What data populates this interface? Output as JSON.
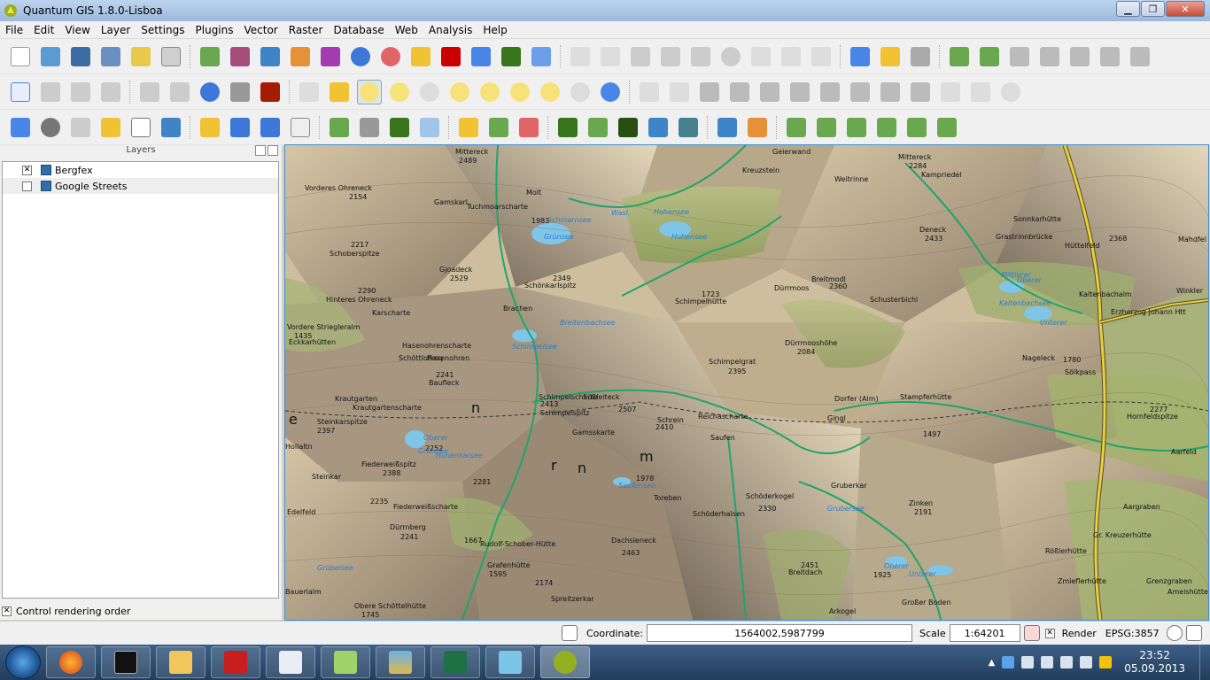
{
  "window": {
    "title": "Quantum GIS 1.8.0-Lisboa"
  },
  "menu": [
    "File",
    "Edit",
    "View",
    "Layer",
    "Settings",
    "Plugins",
    "Vector",
    "Raster",
    "Database",
    "Web",
    "Analysis",
    "Help"
  ],
  "layers": {
    "panel_title": "Layers",
    "items": [
      {
        "label": "Bergfex",
        "checked": true
      },
      {
        "label": "Google Streets",
        "checked": false
      }
    ],
    "control_rendering_order": "Control rendering order"
  },
  "map": {
    "labels": [
      "Mittereck",
      "2489",
      "Vorderes Ohreneck",
      "2154",
      "Gamskarl",
      "Tuchmoarscharte",
      "Molt",
      "1983",
      "Schmarnsee",
      "Grünsee",
      "Wasl.",
      "Hohensee",
      "Hohensee",
      "Geierwand",
      "Weitrinne",
      "Kreuzstein",
      "Mittereck",
      "2284",
      "Kampriedel",
      "Deneck",
      "2433",
      "Sonnkarhütte",
      "Grastrinnbrücke",
      "Hüttelfeld",
      "2368",
      "Mahdfel",
      "Schoberspitze",
      "2217",
      "Gjoadeck",
      "2529",
      "Schönkarlspitz",
      "2349",
      "Schimpelhütte",
      "1723",
      "Breitmodl",
      "2360",
      "Schusterbichl",
      "Mittlerer",
      "Kaltenbachsee",
      "Kaltenbachalm",
      "Erzherzog Johann Htt",
      "Winkler",
      "Hinteres Ohreneck",
      "2290",
      "Karscharte",
      "Brachen",
      "Breitenbachsee",
      "Dürrmoos",
      "Dürrmooshöhe",
      "2084",
      "Oberer",
      "Unterer",
      "Nageleck",
      "1780",
      "Sölkpass",
      "Vordere Striegleralm",
      "1435",
      "Eckkarhütten",
      "Hasenohrenscharte",
      "Hasenohren",
      "Schimpelsee",
      "Schimpelgrat",
      "2395",
      "Baufleck",
      "2241",
      "Krautgarten",
      "Krautgartenscharte",
      "Schöttlofkoq",
      "2413",
      "Schimpelscharte",
      "Süßleiteck",
      "2507",
      "Schimpelspitz",
      "Schrein",
      "2410",
      "Reichascharte",
      "Dorfer (Alm)",
      "Gingl",
      "Stampferhütte",
      "1497",
      "Hornfeldspitze",
      "2277",
      "Steinkarspitze",
      "2397",
      "Hollaltn",
      "Oberer",
      "2252",
      "Grünsee",
      "Hohenkarsee",
      "Gamsskarte",
      "Saufen",
      "Aarfeld",
      "Fiederweißspitz",
      "2388",
      "Steinkar",
      "2281",
      "1978",
      "Saufensee",
      "Toreben",
      "Schöderkogel",
      "2330",
      "Grubersee",
      "Gruberkar",
      "Zinken",
      "2191",
      "Aargraben",
      "Edelfeld",
      "2235",
      "Fiederweißscharte",
      "Dürrnberg",
      "2241",
      "1667",
      "Rudolf-Schober-Hütte",
      "Dachsleneck",
      "2463",
      "Gr. Kreuzerhütte",
      "Rößlerhütte",
      "Grafenhütte",
      "1595",
      "2174",
      "2451",
      "Breitdach",
      "Oberer",
      "Unterer",
      "Zmieflerhütte",
      "Grenzgraben",
      "Ameishütte",
      "Grübelsee",
      "Spreitzerkar",
      "Bauerlalm",
      "Obere Schöttelhütte",
      "1745",
      "Arkogel",
      "Großer Boden",
      "Schöderhalsen",
      "1925"
    ],
    "big_letters": [
      "e",
      "n",
      "r",
      "n",
      "m"
    ]
  },
  "statusbar": {
    "coordinate_label": "Coordinate:",
    "coordinate_value": "1564002,5987799",
    "scale_label": "Scale",
    "scale_value": "1:64201",
    "render_label": "Render",
    "render_checked": true,
    "crs": "EPSG:3857"
  },
  "taskbar": {
    "apps": [
      "Firefox",
      "Command Prompt",
      "Windows Explorer",
      "Adobe Reader",
      "Document Viewer",
      "Notepad++",
      "Photo Viewer",
      "Excel",
      "Foxit",
      "Quantum GIS"
    ],
    "clock_time": "23:52",
    "clock_date": "05.09.2013"
  },
  "colors": {
    "map_border": "#3d8fd9",
    "road_green": "#1fa56b",
    "road_yellow": "#e8d13a",
    "water": "#7fc5e8",
    "forest": "#9aae6a",
    "rock": "#8c7d69"
  }
}
